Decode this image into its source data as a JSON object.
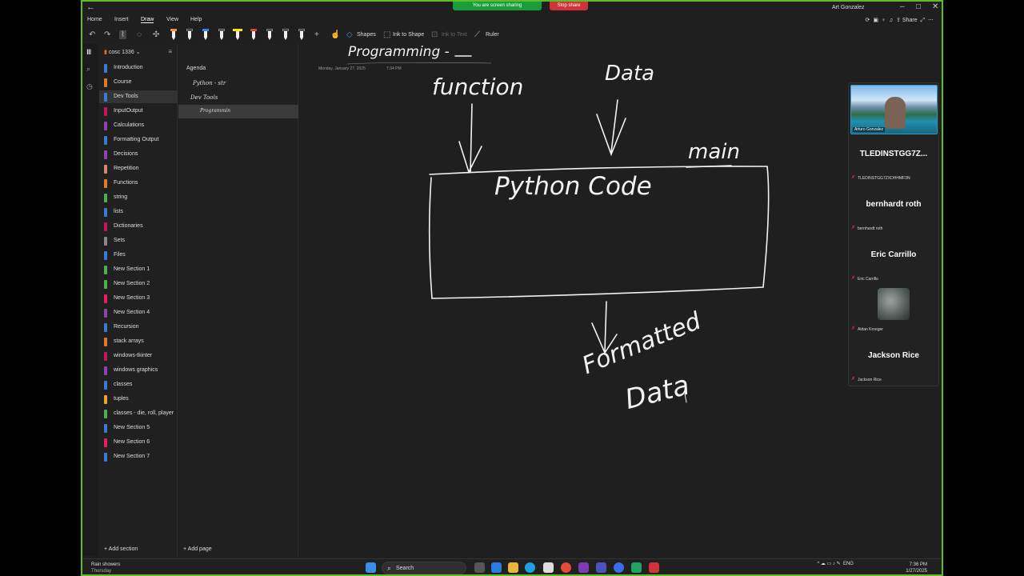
{
  "screen_share": {
    "banner": "You are screen sharing",
    "stop_label": "Stop share"
  },
  "window": {
    "user_name": "Art Gonzalez"
  },
  "menu": {
    "home": "Home",
    "insert": "Insert",
    "draw": "Draw",
    "view": "View",
    "help": "Help",
    "share": "Share"
  },
  "toolbar": {
    "shapes": "Shapes",
    "ink_to_shape": "Ink to Shape",
    "ink_to_text": "Ink to Text",
    "ruler": "Ruler"
  },
  "notebook": {
    "name": "cosc 1336"
  },
  "sections": [
    {
      "label": "Introduction",
      "color": "#3a7bd5"
    },
    {
      "label": "Course",
      "color": "#e07a2a"
    },
    {
      "label": "Dev Tools",
      "color": "#3a7bd5"
    },
    {
      "label": "InputOutput",
      "color": "#c2185b"
    },
    {
      "label": "Calculations",
      "color": "#8e44ad"
    },
    {
      "label": "Formatting Output",
      "color": "#3a7bd5"
    },
    {
      "label": "Decisions",
      "color": "#8e44ad"
    },
    {
      "label": "Repetition",
      "color": "#d08a6a"
    },
    {
      "label": "Functions",
      "color": "#e07a2a"
    },
    {
      "label": "string",
      "color": "#4caf50"
    },
    {
      "label": "lists",
      "color": "#3a7bd5"
    },
    {
      "label": "Dictionaries",
      "color": "#c2185b"
    },
    {
      "label": "Sets",
      "color": "#888888"
    },
    {
      "label": "Files",
      "color": "#3a7bd5"
    },
    {
      "label": "New Section 1",
      "color": "#4caf50"
    },
    {
      "label": "New Section 2",
      "color": "#4caf50"
    },
    {
      "label": "New Section 3",
      "color": "#e91e63"
    },
    {
      "label": "New Section 4",
      "color": "#8e44ad"
    },
    {
      "label": "Recursion",
      "color": "#3a7bd5"
    },
    {
      "label": "stack arrays",
      "color": "#e07a2a"
    },
    {
      "label": "windows-tkinter",
      "color": "#c2185b"
    },
    {
      "label": "windows graphics",
      "color": "#8e44ad"
    },
    {
      "label": "classes",
      "color": "#3a7bd5"
    },
    {
      "label": "tuples",
      "color": "#f0a030"
    },
    {
      "label": "classes - die, roll, player",
      "color": "#4caf50"
    },
    {
      "label": "New Section 5",
      "color": "#3a7bd5"
    },
    {
      "label": "New Section 6",
      "color": "#e91e63"
    },
    {
      "label": "New Section 7",
      "color": "#3a7bd5"
    }
  ],
  "add_section": "Add section",
  "pages": {
    "items": [
      "Agenda",
      "Python - str",
      "Dev Tools",
      "Programmin"
    ],
    "add_page": "Add page"
  },
  "page": {
    "date": "Monday, January 27, 2025",
    "time": "7:34 PM",
    "ink": {
      "title": "Programming -",
      "function": "function",
      "data": "Data",
      "main": "main",
      "python_code": "Python Code",
      "formatted": "Formatted",
      "data2": "Data"
    }
  },
  "participants": [
    {
      "video_name": "Arturo Gonzalez"
    },
    {
      "display": "TLEDINSTGG7Z...",
      "label": "TLEDINSTGG7ZXDHHMF3N"
    },
    {
      "display": "bernhardt roth",
      "label": "bernhardt roth"
    },
    {
      "display": "Eric Carrillo",
      "label": "Eric Carrillo"
    },
    {
      "display": "",
      "label": "Aidan Kroeger"
    },
    {
      "display": "Jackson Rice",
      "label": "Jackson Rice"
    }
  ],
  "taskbar": {
    "weather_line1": "Rain showers",
    "weather_line2": "Thursday",
    "search": "Search",
    "lang": "ENG",
    "time": "7:36 PM",
    "date": "1/27/2025"
  }
}
